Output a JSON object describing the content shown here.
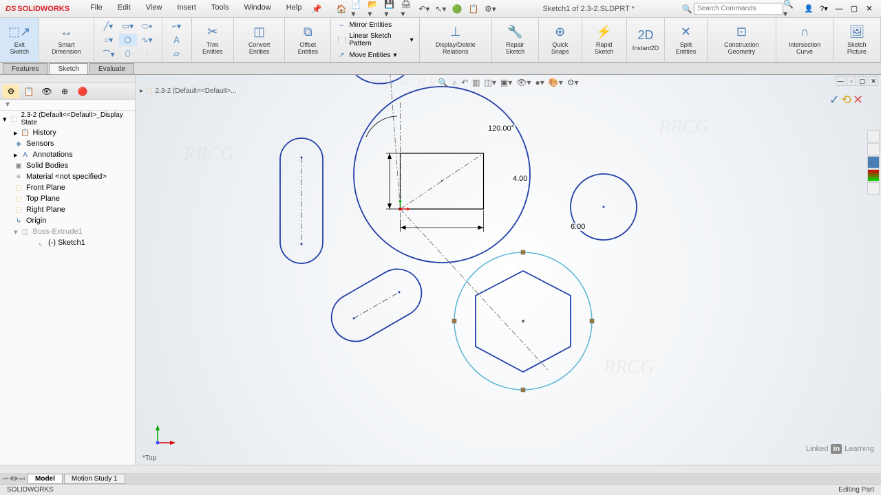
{
  "app": {
    "brand_prefix": "DS",
    "brand_name": "SOLIDWORKS",
    "doc_title": "Sketch1 of 2.3-2.SLDPRT *",
    "search_placeholder": "Search Commands",
    "watermark_url": "WWW.RRCG.CN",
    "watermark_text": "RRCG"
  },
  "menu": [
    "File",
    "Edit",
    "View",
    "Insert",
    "Tools",
    "Window",
    "Help"
  ],
  "tabs": [
    "Features",
    "Sketch",
    "Evaluate"
  ],
  "tabs_active": "Sketch",
  "ribbon": {
    "exit_sketch": "Exit Sketch",
    "smart_dimension": "Smart Dimension",
    "trim_entities": "Trim Entities",
    "convert_entities": "Convert Entities",
    "offset_entities": "Offset Entities",
    "mirror_entities": "Mirror Entities",
    "linear_pattern": "Linear Sketch Pattern",
    "move_entities": "Move Entities",
    "display_delete": "Display/Delete Relations",
    "repair_sketch": "Repair Sketch",
    "quick_snaps": "Quick Snaps",
    "rapid_sketch": "Rapid Sketch",
    "instant2d": "Instant2D",
    "split_entities": "Split Entities",
    "construction_geometry": "Construction Geometry",
    "intersection_curve": "Intersection Curve",
    "sketch_picture": "Sketch Picture"
  },
  "tree": {
    "root": "2.3-2 (Default<<Default>_Display State",
    "items": [
      {
        "icon": "📋",
        "label": "History"
      },
      {
        "icon": "◈",
        "label": "Sensors"
      },
      {
        "icon": "A",
        "label": "Annotations"
      },
      {
        "icon": "▣",
        "label": "Solid Bodies"
      },
      {
        "icon": "≡",
        "label": "Material <not specified>"
      },
      {
        "icon": "⬚",
        "label": "Front Plane"
      },
      {
        "icon": "⬚",
        "label": "Top Plane"
      },
      {
        "icon": "⬚",
        "label": "Right Plane"
      },
      {
        "icon": "↳",
        "label": "Origin"
      },
      {
        "icon": "◫",
        "label": "Boss-Extrude1"
      },
      {
        "icon": "⌞",
        "label": "(-) Sketch1",
        "indent": 3
      }
    ]
  },
  "breadcrumb": "2.3-2  (Default<<Default>...",
  "dimensions": {
    "angle": "120.00°",
    "height": "4.00",
    "width": "6.00"
  },
  "bottom_tabs": [
    "Model",
    "Motion Study 1"
  ],
  "bottom_tabs_active": "Model",
  "view_label": "*Top",
  "status": {
    "left": "SOLIDWORKS",
    "right": "Editing Part"
  },
  "linkedin": {
    "prefix": "Linked",
    "in": "in",
    "suffix": "Learning"
  }
}
